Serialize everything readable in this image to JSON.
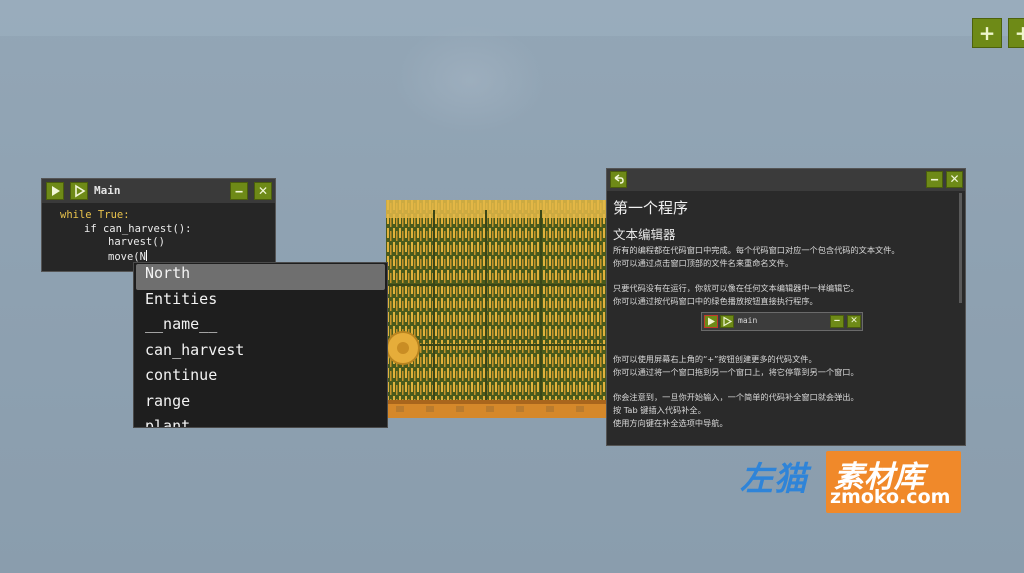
{
  "toolbar": {
    "add_label": "+",
    "second_label": "+"
  },
  "code_window": {
    "title": "Main",
    "run_icon": "play-filled-icon",
    "step_icon": "play-outline-icon",
    "minimize": "‒",
    "close": "✕",
    "lines": [
      "while True:",
      "if can_harvest():",
      "harvest()",
      "move(N"
    ]
  },
  "autocomplete": {
    "selected_index": 0,
    "items": [
      "North",
      "Entities",
      "__name__",
      "can_harvest",
      "continue",
      "range",
      "plant"
    ]
  },
  "doc_window": {
    "back_icon": "back-arrow-icon",
    "minimize": "‒",
    "close": "✕",
    "title": "第一个程序",
    "subtitle": "文本编辑器",
    "para1": [
      "所有的编程都在代码窗口中完成。每个代码窗口对应一个包含代码的文本文件。",
      "你可以通过点击窗口顶部的文件名来重命名文件。"
    ],
    "para2": [
      "只要代码没有在运行，你就可以像在任何文本编辑器中一样编辑它。",
      "你可以通过按代码窗口中的绿色播放按钮直接执行程序。"
    ],
    "mini_window_title": "main",
    "para3": [
      "你可以使用屏幕右上角的“+”按钮创建更多的代码文件。",
      "你可以通过将一个窗口拖到另一个窗口上，将它停靠到另一个窗口。"
    ],
    "para4": [
      "你会注意到，一旦你开始输入，一个简单的代码补全窗口就会弹出。",
      "按 Tab 键插入代码补全。",
      "使用方向键在补全选项中导航。"
    ]
  },
  "watermark": {
    "left": "左猫",
    "right": "素材库",
    "domain": "zmoko.com"
  },
  "colors": {
    "button_green": "#6e8a17",
    "keyword": "#e8c24c",
    "wheat": "#d9a836",
    "sky": "#8ea1b1"
  }
}
